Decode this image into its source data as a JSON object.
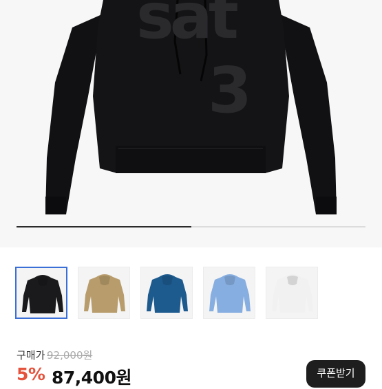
{
  "product": {
    "hero_logo_text": "sat",
    "hero_logo_number": "3",
    "image_progress": 0.5
  },
  "colors": {
    "accent_discount": "#e5533d",
    "selected_border": "#3a6fd8",
    "coupon_bg": "#1e1e1e"
  },
  "thumbnails": [
    {
      "name": "black",
      "color": "#1a1a1c",
      "selected": true
    },
    {
      "name": "beige",
      "color": "#b89c6c",
      "selected": false
    },
    {
      "name": "navy-blue",
      "color": "#1d5a8e",
      "selected": false
    },
    {
      "name": "light-blue",
      "color": "#86aee0",
      "selected": false
    },
    {
      "name": "white",
      "color": "#f1f1f1",
      "selected": false
    }
  ],
  "pricing": {
    "label": "구매가",
    "original": "92,000원",
    "discount": "5%",
    "final": "87,400원",
    "coupon_button": "쿠폰받기"
  }
}
